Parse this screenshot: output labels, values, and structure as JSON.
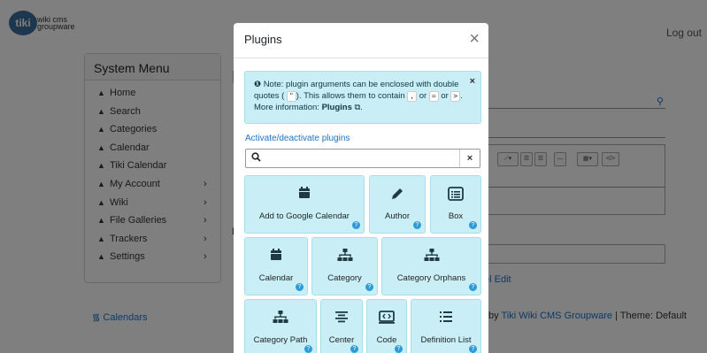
{
  "header": {
    "logo_badge": "tiki",
    "logo_text": "wiki cms groupware",
    "logout": "Log out"
  },
  "sidebar": {
    "title": "System Menu",
    "items": [
      {
        "label": "Home",
        "has_chevron": false
      },
      {
        "label": "Search",
        "has_chevron": false
      },
      {
        "label": "Categories",
        "has_chevron": false
      },
      {
        "label": "Calendar",
        "has_chevron": false
      },
      {
        "label": "Tiki Calendar",
        "has_chevron": false
      },
      {
        "label": "My Account",
        "has_chevron": true
      },
      {
        "label": "Wiki",
        "has_chevron": true
      },
      {
        "label": "File Galleries",
        "has_chevron": true
      },
      {
        "label": "Trackers",
        "has_chevron": true
      },
      {
        "label": "Settings",
        "has_chevron": true
      }
    ],
    "calendars_link": "Calendars"
  },
  "background": {
    "edit_link": "el Edit",
    "footer_prefix": "by ",
    "footer_link": "Tiki Wiki CMS Groupware",
    "footer_suffix": " | Theme: Default"
  },
  "modal": {
    "title": "Plugins",
    "close": "×",
    "note": {
      "prefix": "Note: plugin arguments can be enclosed with double quotes (",
      "quote_key": "\"",
      "mid1": "). This allows them to contain",
      "comma_key": ",",
      "mid2": "or",
      "equals_key": "=",
      "mid3": "or",
      "gt_key": ">",
      "mid4": ". More information:",
      "link": "Plugins",
      "dismiss": "×"
    },
    "activate_link": "Activate/deactivate plugins",
    "filter": {
      "value": "",
      "placeholder": "",
      "clear": "×"
    },
    "tiles": [
      {
        "label": "Add to Google Calendar",
        "icon": "calendar-icon"
      },
      {
        "label": "Author",
        "icon": "pen-icon"
      },
      {
        "label": "Box",
        "icon": "box-icon"
      },
      {
        "label": "Calendar",
        "icon": "calendar-icon"
      },
      {
        "label": "Category",
        "icon": "sitemap-icon"
      },
      {
        "label": "Category Orphans",
        "icon": "sitemap-icon"
      },
      {
        "label": "Category Path",
        "icon": "sitemap-icon"
      },
      {
        "label": "Center",
        "icon": "align-center-icon"
      },
      {
        "label": "Code",
        "icon": "code-icon"
      },
      {
        "label": "Definition List",
        "icon": "list-icon"
      }
    ],
    "help_glyph": "?"
  },
  "colors": {
    "overlay": "rgba(0,0,0,0.5)",
    "note_bg": "#c9eef5",
    "link": "#1a73c9",
    "help_badge": "#2d9bd6",
    "icon_dark": "#1f3a44"
  }
}
